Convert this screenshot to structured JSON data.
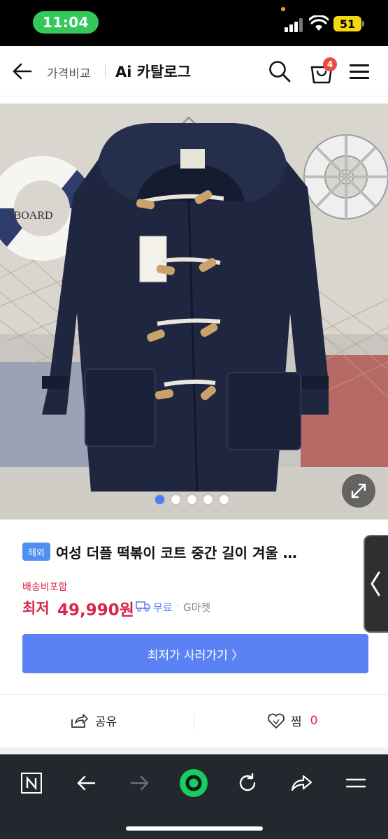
{
  "status_bar": {
    "time": "11:04",
    "battery": "51"
  },
  "header": {
    "breadcrumb_compare": "가격비교",
    "breadcrumb_catalog": "Ai 카탈로그",
    "cart_count": "4"
  },
  "product": {
    "overseas_badge": "해외",
    "title": "여성 더플 떡볶이 코트 중간 길이 겨울 …",
    "shipping_included": "배송비포함",
    "price_label": "최저",
    "price": "49,990원",
    "free_shipping": "무료",
    "separator": "·",
    "seller": "G마켓",
    "buy_button": "최저가 사러가기 〉",
    "gallery_total": 5,
    "gallery_active_index": 0
  },
  "actions": {
    "share": "공유",
    "favorite": "찜",
    "favorite_count": "0"
  },
  "colors": {
    "accent": "#5b82f5",
    "price": "#d6284b",
    "badge_blue": "#4f8ff0",
    "status_green": "#34c759",
    "battery_yellow": "#f3d70f",
    "browser_bar": "#24272e",
    "home_green": "#19ce60"
  },
  "icons": {
    "header": [
      "back-arrow-icon",
      "search-icon",
      "shopping-bag-icon",
      "hamburger-menu-icon"
    ],
    "browser_bar": [
      "naver-n-icon",
      "back-arrow-icon",
      "forward-arrow-icon",
      "home-green-circle-icon",
      "refresh-icon",
      "share-arrow-icon",
      "menu-icon"
    ]
  }
}
